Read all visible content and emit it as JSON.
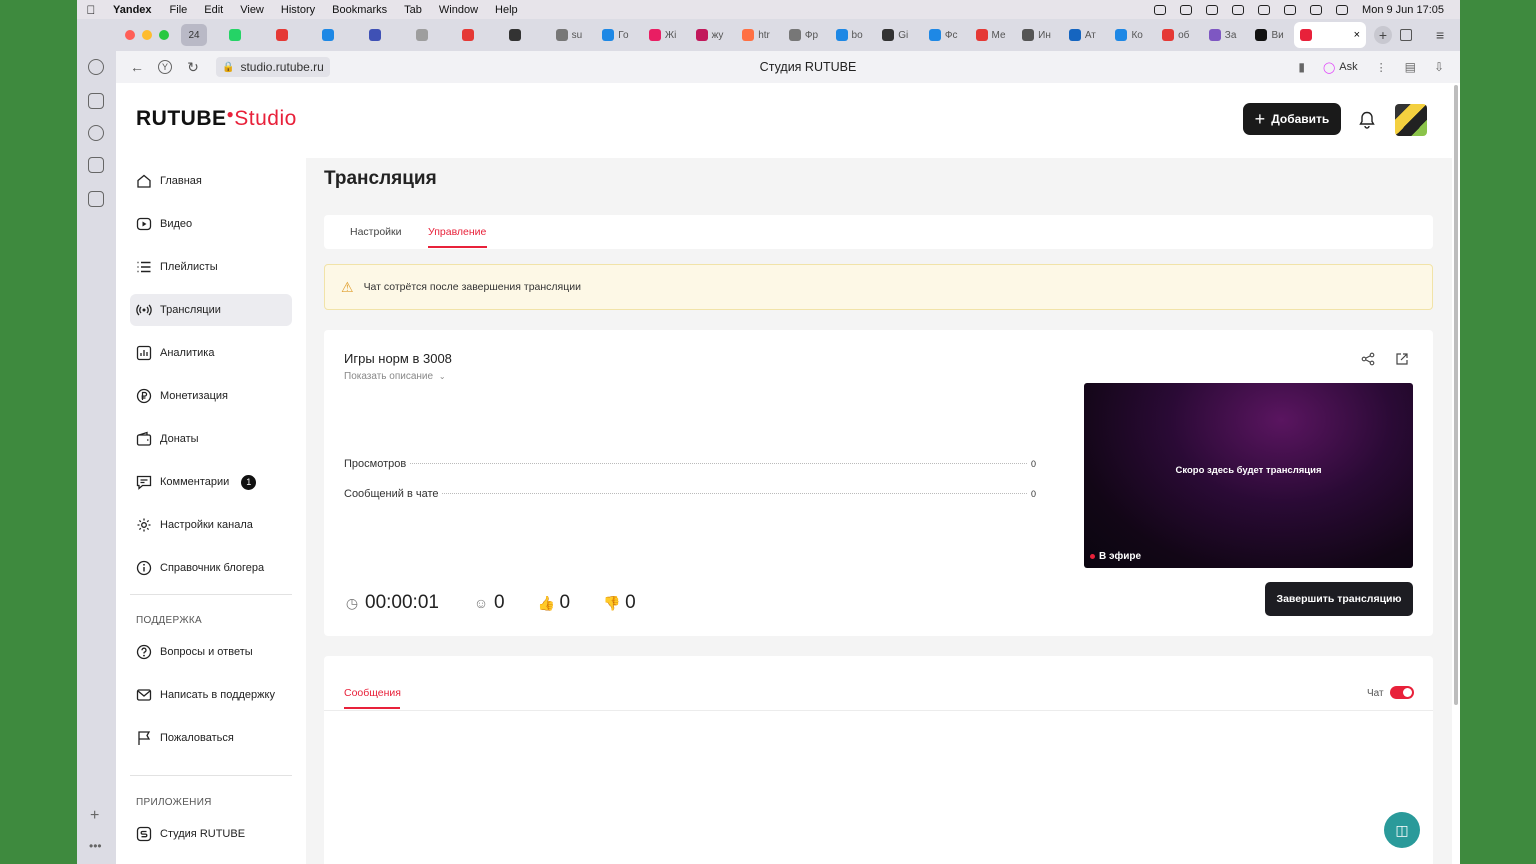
{
  "menubar": {
    "app": "Yandex",
    "items": [
      "File",
      "Edit",
      "View",
      "History",
      "Bookmarks",
      "Tab",
      "Window",
      "Help"
    ],
    "datetime": "Mon 9 Jun  17:05"
  },
  "tabstrip": {
    "tab_count": "24",
    "tabs": [
      {
        "label": "",
        "color": "#25d366"
      },
      {
        "label": "",
        "color": "#e53935"
      },
      {
        "label": "",
        "color": "#1e88e5"
      },
      {
        "label": "",
        "color": "#3f51b5"
      },
      {
        "label": "",
        "color": "#9e9e9e"
      },
      {
        "label": "",
        "color": "#e53935"
      },
      {
        "label": "",
        "color": "#333333"
      },
      {
        "label": "su",
        "color": "#777777"
      },
      {
        "label": "Го",
        "color": "#1e88e5"
      },
      {
        "label": "Жі",
        "color": "#e91e63"
      },
      {
        "label": "жу",
        "color": "#c2185b"
      },
      {
        "label": "htr",
        "color": "#ff7043"
      },
      {
        "label": "Фр",
        "color": "#777777"
      },
      {
        "label": "bo",
        "color": "#1e88e5"
      },
      {
        "label": "Gi",
        "color": "#333333"
      },
      {
        "label": "Фс",
        "color": "#1e88e5"
      },
      {
        "label": "Ме",
        "color": "#e53935"
      },
      {
        "label": "Ин",
        "color": "#555555"
      },
      {
        "label": "Ат",
        "color": "#1565c0"
      },
      {
        "label": "Ко",
        "color": "#1e88e5"
      },
      {
        "label": "об",
        "color": "#e53935"
      },
      {
        "label": "За",
        "color": "#7e57c2"
      },
      {
        "label": "Ви",
        "color": "#111111"
      }
    ],
    "active_tab_close": "×"
  },
  "addressbar": {
    "url": "studio.rutube.ru",
    "page_title": "Студия RUTUBE",
    "ask_label": "Ask"
  },
  "header": {
    "logo_main": "RUTUBE",
    "logo_studio": "Studio",
    "add_button": "Добавить"
  },
  "sidebar": {
    "items": [
      {
        "label": "Главная",
        "icon": "home-icon"
      },
      {
        "label": "Видео",
        "icon": "video-icon"
      },
      {
        "label": "Плейлисты",
        "icon": "playlist-icon"
      },
      {
        "label": "Трансляции",
        "icon": "broadcast-icon"
      },
      {
        "label": "Аналитика",
        "icon": "analytics-icon"
      },
      {
        "label": "Монетизация",
        "icon": "ruble-icon"
      },
      {
        "label": "Донаты",
        "icon": "wallet-icon"
      },
      {
        "label": "Комментарии",
        "icon": "comment-icon",
        "badge": "1"
      },
      {
        "label": "Настройки канала",
        "icon": "gear-icon"
      },
      {
        "label": "Справочник блогера",
        "icon": "info-icon"
      }
    ],
    "support_heading": "ПОДДЕРЖКА",
    "support_items": [
      {
        "label": "Вопросы и ответы",
        "icon": "question-icon"
      },
      {
        "label": "Написать в поддержку",
        "icon": "mail-icon"
      },
      {
        "label": "Пожаловаться",
        "icon": "flag-icon"
      }
    ],
    "apps_heading": "ПРИЛОЖЕНИЯ",
    "apps_items": [
      {
        "label": "Студия RUTUBE",
        "icon": "studio-app-icon"
      }
    ]
  },
  "main": {
    "title": "Трансляция",
    "tabs": [
      {
        "label": "Настройки"
      },
      {
        "label": "Управление",
        "active": true
      }
    ],
    "warning": "Чат сотрётся после завершения трансляции",
    "stream": {
      "title": "Игры норм в 3008",
      "show_description": "Показать описание",
      "stats": [
        {
          "label": "Просмотров",
          "value": "0"
        },
        {
          "label": "Сообщений в чате",
          "value": "0"
        }
      ],
      "duration": "00:00:01",
      "viewers": "0",
      "likes": "0",
      "dislikes": "0",
      "preview_text": "Скоро здесь будет трансляция",
      "live_label": "В эфире",
      "end_button": "Завершить трансляцию"
    },
    "chat": {
      "messages_tab": "Сообщения",
      "chat_label": "Чат",
      "chat_enabled": true
    }
  },
  "colors": {
    "accent": "#e8213a",
    "dark_button": "#1a1a1a",
    "warning_bg": "#fdf8e6"
  }
}
